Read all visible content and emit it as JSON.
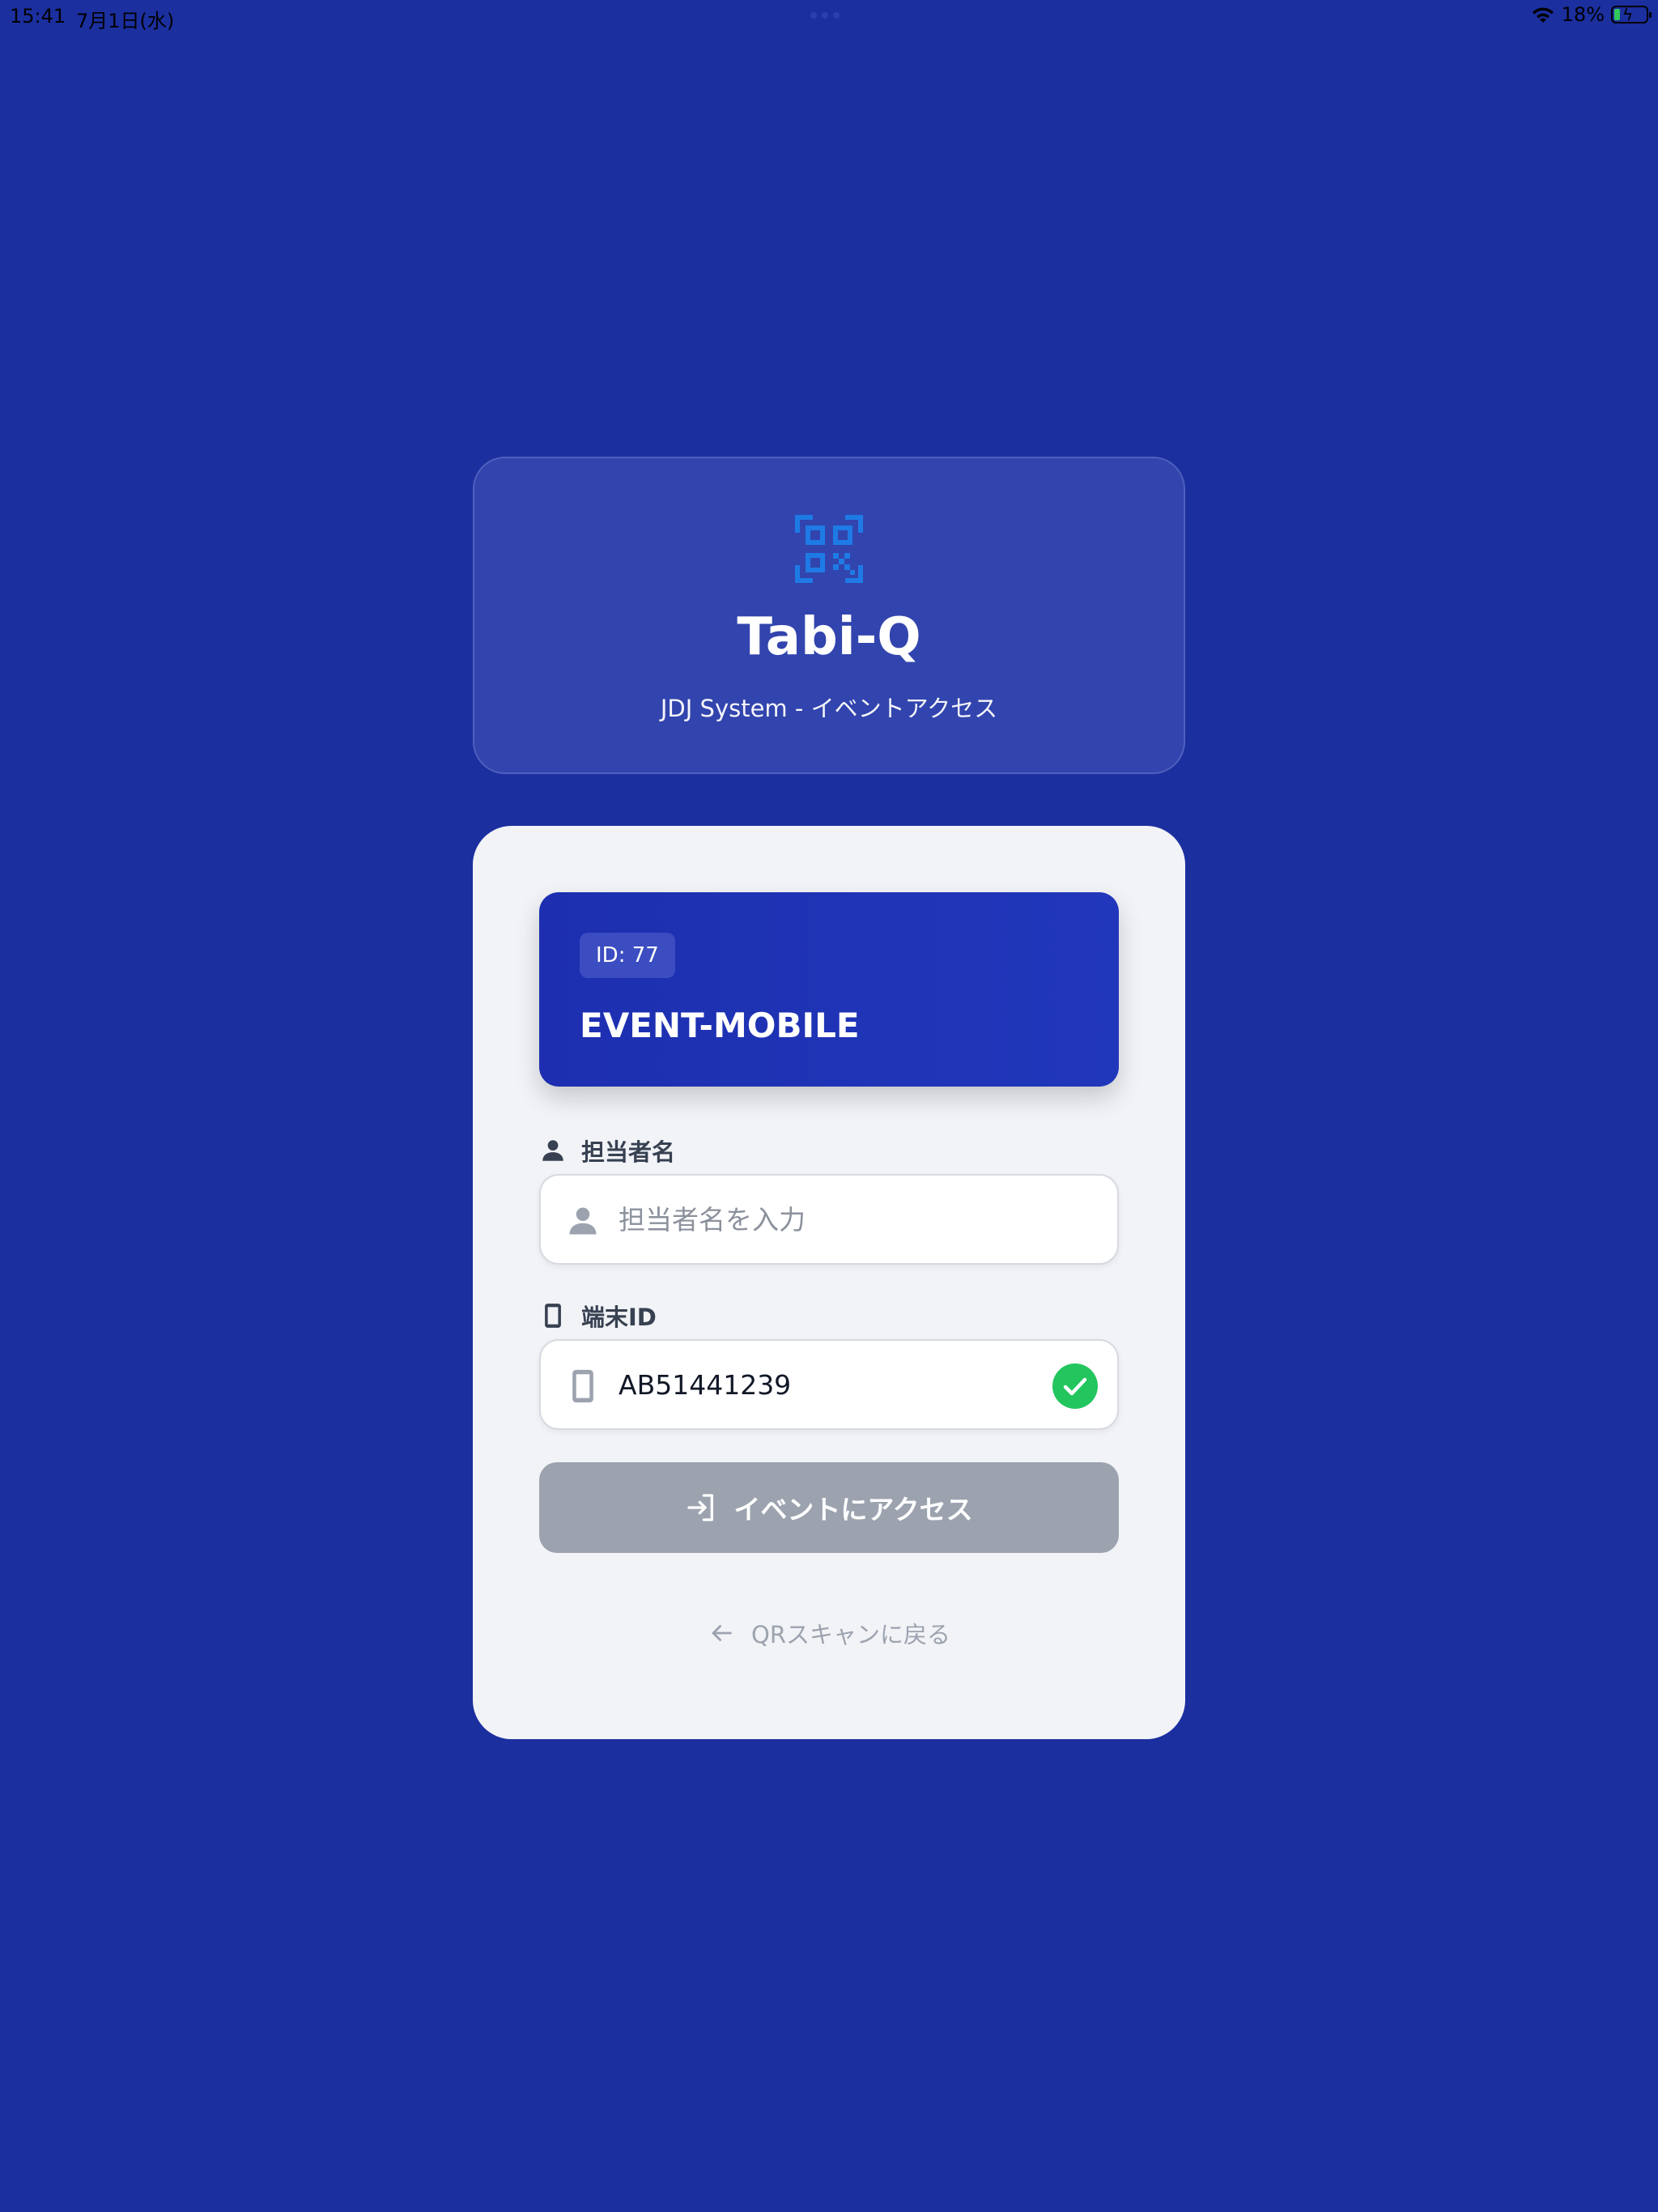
{
  "status_bar": {
    "time": "15:41",
    "date": "7月1日(水)",
    "battery_text": "18%",
    "battery_level": 0.18,
    "icons": [
      "wifi-icon",
      "battery-charging-icon"
    ]
  },
  "header": {
    "icon": "qr-code-icon",
    "icon_color": "#1e7be6",
    "title": "Tabi-Q",
    "subtitle": "JDJ System - イベントアクセス"
  },
  "event": {
    "id_badge": "ID: 77",
    "name": "EVENT-MOBILE"
  },
  "form": {
    "staff_name": {
      "label": "担当者名",
      "placeholder": "担当者名を入力",
      "value": "",
      "icon": "person-icon"
    },
    "device_id": {
      "label": "端末ID",
      "value": "AB51441239",
      "icon": "smartphone-icon",
      "valid": true
    },
    "submit_label": "イベントにアクセス",
    "submit_disabled": true,
    "back_label": "QRスキャンに戻る"
  },
  "colors": {
    "background": "#1b2f9f",
    "event_card": "#1f33b6",
    "success": "#22c55e",
    "disabled_button": "#9ca3af"
  }
}
